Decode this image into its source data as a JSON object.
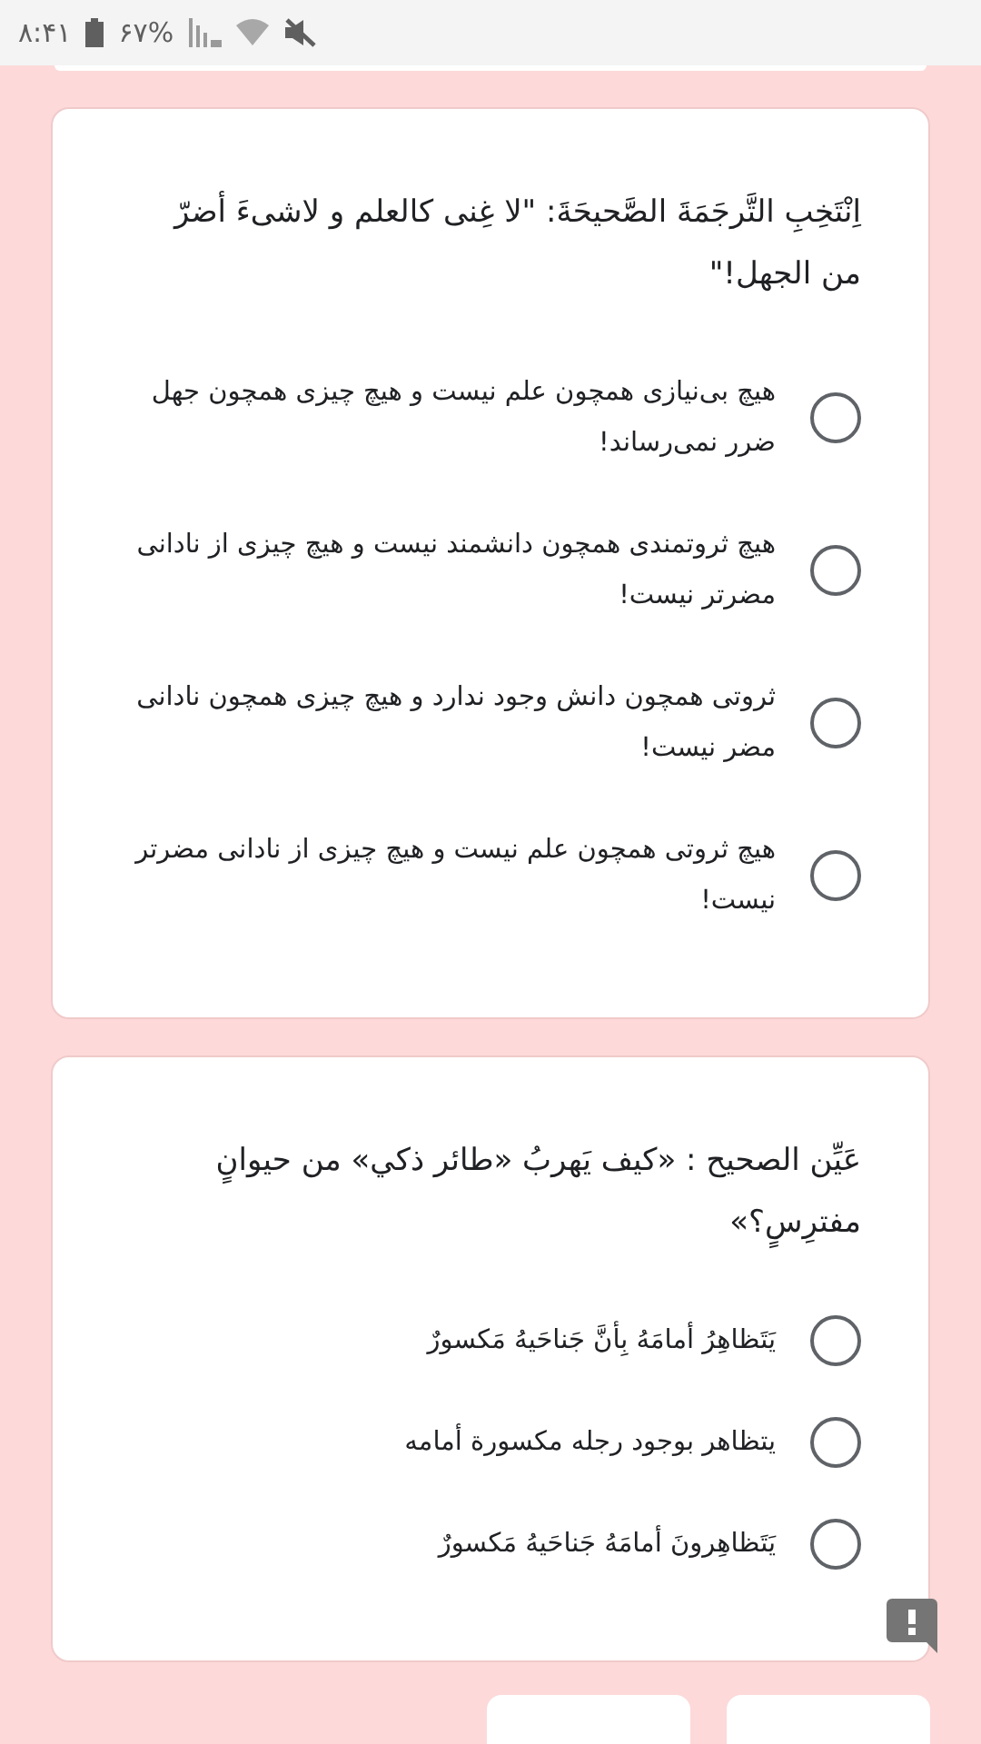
{
  "status_bar": {
    "time": "۸:۴۱",
    "battery": "۶۷%"
  },
  "questions": [
    {
      "text": "اِنْتَخِبِ التَّرجَمَةَ الصَّحيحَةَ: \"لا غِنی کالعلم و لاشیءَ أضرّ من الجهل!\"",
      "options": [
        {
          "label": "هیچ بی‌نیازی همچون علم نیست و هیچ چیزی همچون جهل ضرر نمی‌رساند!",
          "selected": false
        },
        {
          "label": "هیچ ثروتمندی همچون دانشمند نیست و هیچ چیزی از نادانی مضرتر نیست!",
          "selected": false
        },
        {
          "label": "ثروتی همچون دانش وجود ندارد و هیچ چیزی همچون نادانی مضر نیست!",
          "selected": false
        },
        {
          "label": "هیچ ثروتی همچون علم نیست و هیچ چیزی از نادانی مضرتر نیست!",
          "selected": false
        }
      ]
    },
    {
      "text": "عَيِّن الصحيح : «كيف يَهربُ «طائر ذكي» من حيوانٍ مفترِسٍ؟»",
      "options": [
        {
          "label": "يَتَظاهِرُ أمامَهُ بِأنَّ جَناحَيهُ مَكسورٌ",
          "selected": false
        },
        {
          "label": "يتظاهر بوجود رجله مكسورة أمامه",
          "selected": false
        },
        {
          "label": "يَتَظاهِرونَ أمامَهُ جَناحَيهُ مَكسورٌ",
          "selected": false
        }
      ]
    }
  ]
}
